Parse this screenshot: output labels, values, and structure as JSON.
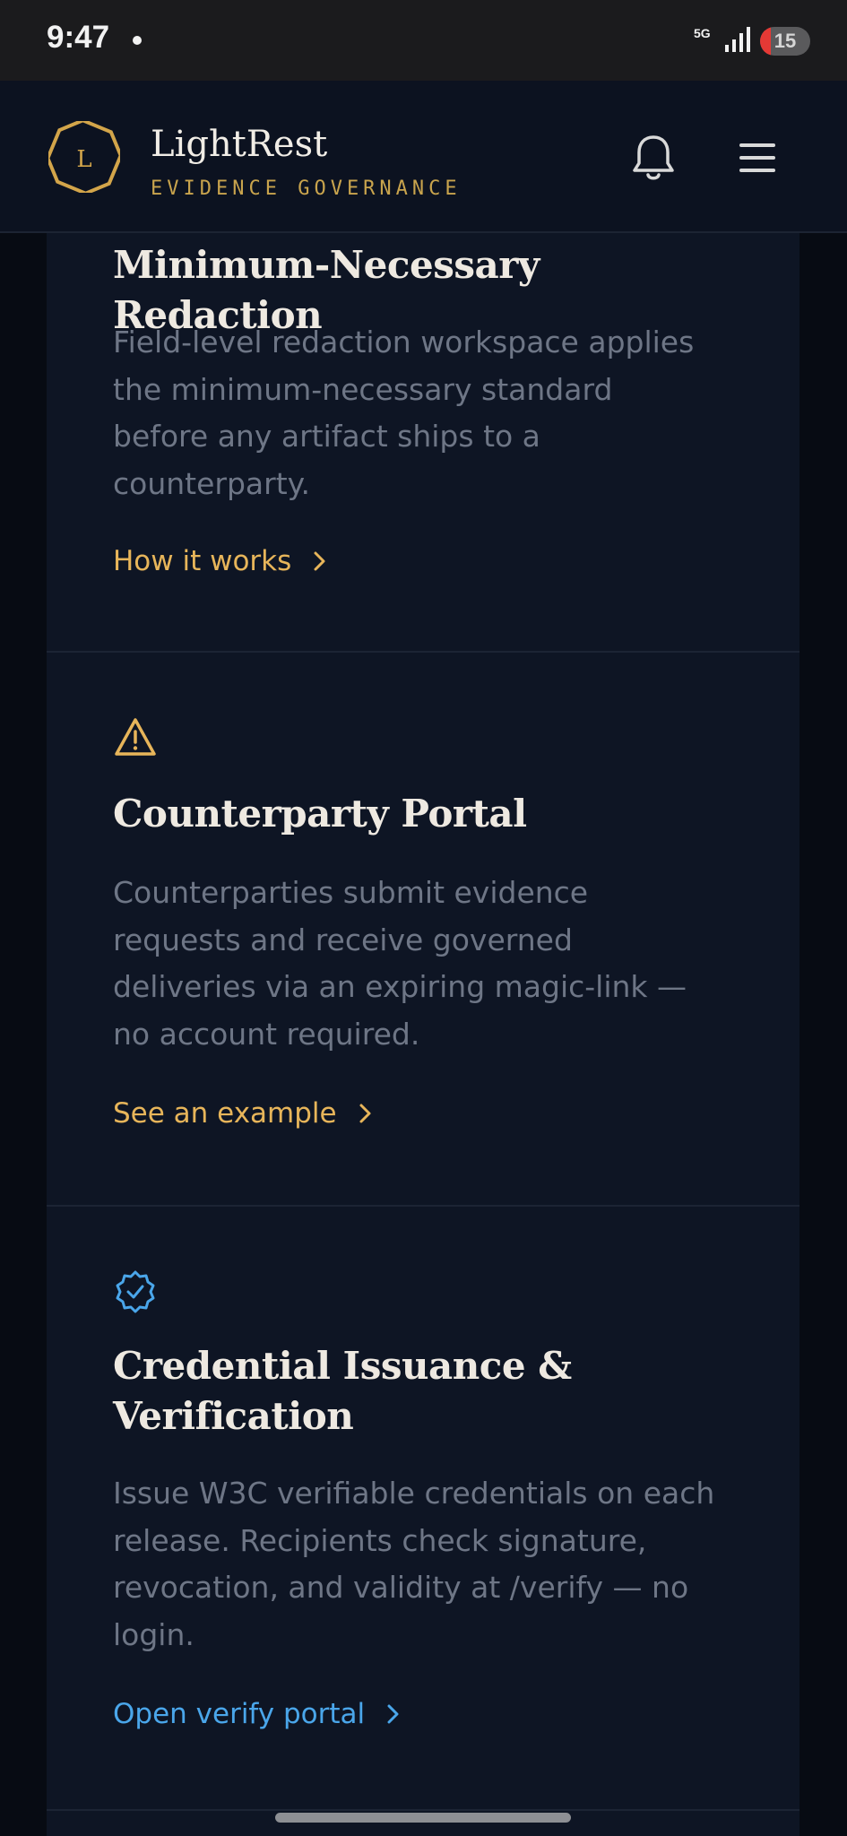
{
  "status_bar": {
    "time": "9:47",
    "network": "5G",
    "battery": "15"
  },
  "header": {
    "logo_letter": "L",
    "brand_name": "LightRest",
    "brand_tagline": "EVIDENCE GOVERNANCE"
  },
  "cards": [
    {
      "title": "Minimum-Necessary Redaction",
      "body": [
        "Field-level redaction workspace applies",
        "the minimum-necessary standard",
        "before any artifact ships to a",
        "counterparty."
      ],
      "link": "How it works",
      "icon": "none-visible"
    },
    {
      "title": "Counterparty Portal",
      "body": [
        "Counterparties submit evidence",
        "requests and receive governed",
        "deliveries via an expiring magic-link —",
        "no account required."
      ],
      "link": "See an example",
      "icon": "warning-icon"
    },
    {
      "title_lines": [
        "Credential Issuance &",
        "Verification"
      ],
      "body": [
        "Issue W3C verifiable credentials on each",
        "release. Recipients check signature,",
        "revocation, and validity at /verify — no",
        "login."
      ],
      "link": "Open verify portal",
      "icon": "verified-badge-icon"
    }
  ],
  "colors": {
    "accent_gold": "#e7b55a",
    "accent_blue": "#4aa6ea",
    "card_bg": "#0e1524",
    "page_bg": "#070b13"
  }
}
